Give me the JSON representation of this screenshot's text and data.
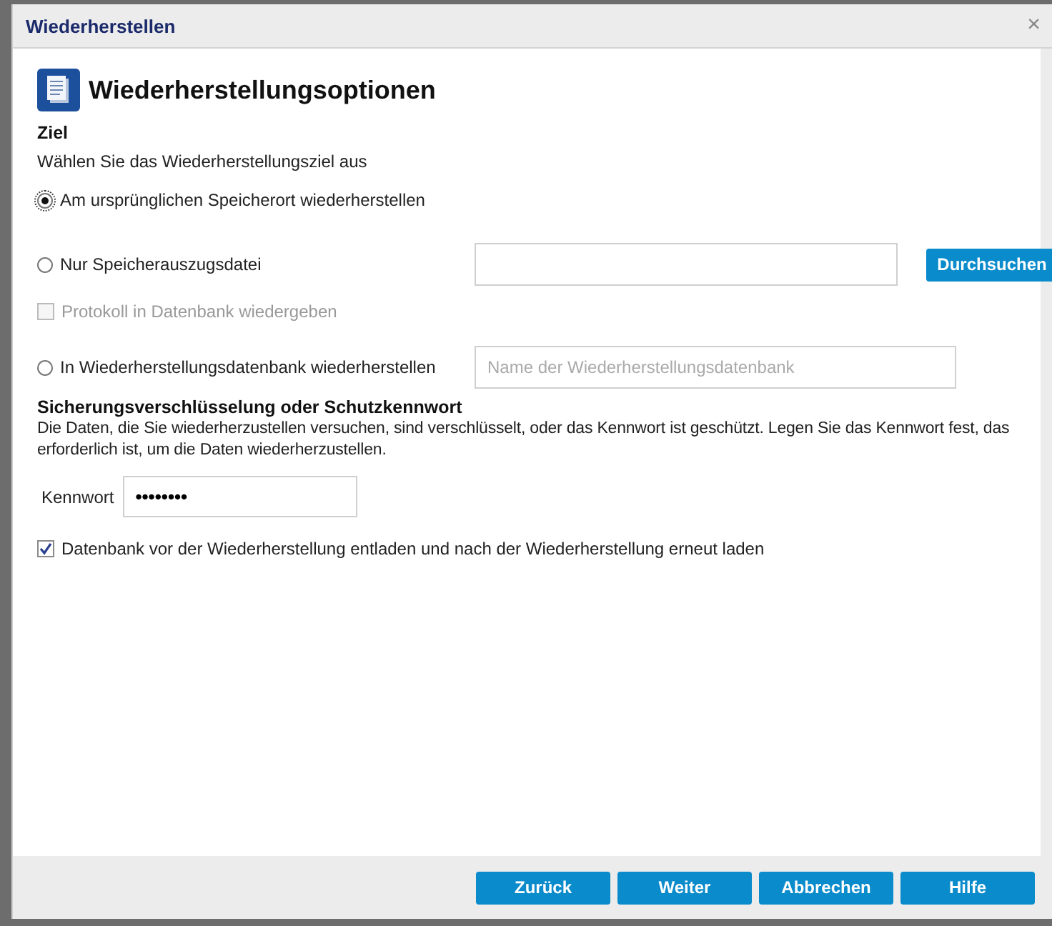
{
  "window": {
    "title": "Wiederherstellen",
    "close": "×"
  },
  "header": {
    "title": "Wiederherstellungsoptionen"
  },
  "destination": {
    "heading": "Ziel",
    "instruction": "Wählen Sie das Wiederherstellungsziel aus",
    "options": [
      {
        "kind": "radio",
        "label": "Am ursprünglichen Speicherort wiederherstellen",
        "selected": true
      },
      {
        "kind": "radio-browse",
        "label": "Nur Speicherauszugsdatei",
        "selected": false,
        "button": "Durchsuchen"
      },
      {
        "kind": "checkbox",
        "label": "Protokoll in Datenbank wiedergeben",
        "checked": false,
        "disabled": true
      },
      {
        "kind": "radio-input",
        "label": "In Wiederherstellungsdatenbank wiederherstellen",
        "selected": false,
        "placeholder": "Name der Wiederherstellungsdatenbank"
      }
    ]
  },
  "encryption": {
    "heading": "Sicherungsverschlüsselung oder Schutzkennwort",
    "description": "Die Daten, die Sie wiederherzustellen versuchen, sind verschlüsselt, oder das Kennwort ist geschützt. Legen Sie das Kennwort fest, das erforderlich ist, um die Daten wiederherzustellen.",
    "password_label": "Kennwort",
    "password": "••••••••"
  },
  "reload": {
    "label": "Datenbank vor der Wiederherstellung entladen und nach der Wiederherstellung erneut laden",
    "checked": true,
    "disabled": false
  },
  "buttons": [
    "Zurück",
    "Weiter",
    "Abbrechen",
    "Hilfe"
  ]
}
